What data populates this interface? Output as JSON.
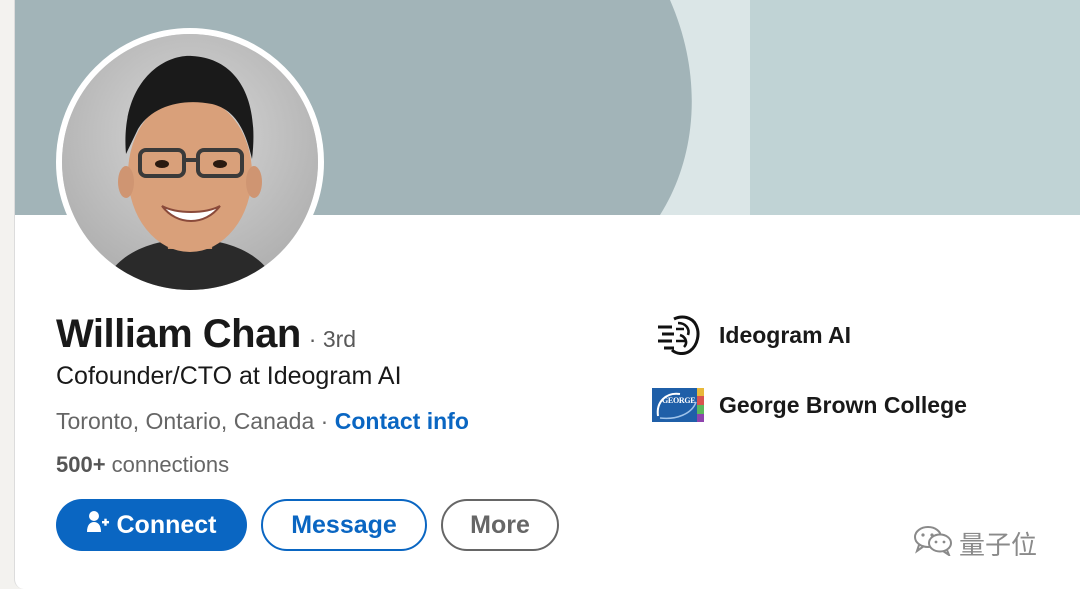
{
  "profile": {
    "name": "William Chan",
    "degree": "· 3rd",
    "headline": "Cofounder/CTO at Ideogram AI",
    "location": "Toronto, Ontario, Canada",
    "location_separator": " · ",
    "contact_info": "Contact info",
    "connections_count": "500+",
    "connections_label": " connections"
  },
  "actions": {
    "connect": "Connect",
    "message": "Message",
    "more": "More"
  },
  "orgs": [
    {
      "name": "Ideogram AI",
      "icon": "ideogram-logo"
    },
    {
      "name": "George Brown College",
      "icon": "george-brown-logo",
      "logo_text": "GEORGE BROWN"
    }
  ],
  "watermark": {
    "text": "量子位",
    "icon": "wechat-icon"
  },
  "colors": {
    "accent": "#0a66c2",
    "banner": "#a2b4b8",
    "text_primary": "#191919",
    "text_secondary": "#666666"
  }
}
